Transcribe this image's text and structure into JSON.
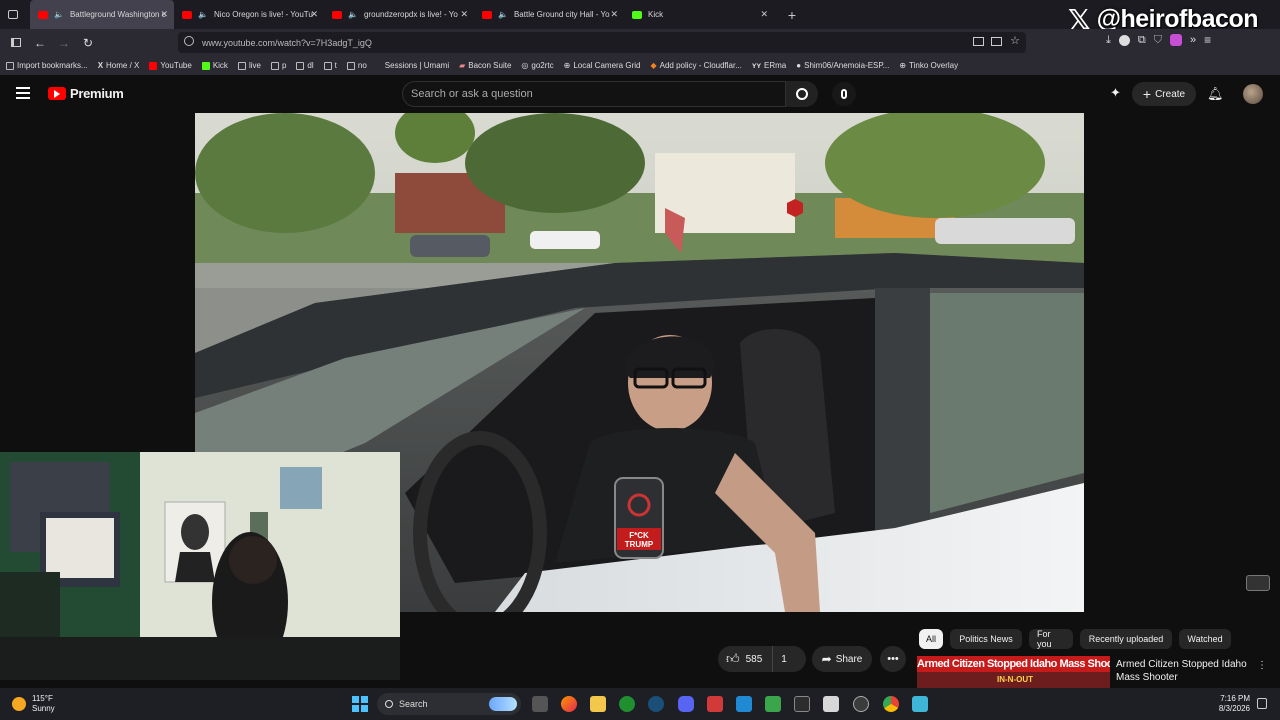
{
  "tabs": [
    {
      "title": "Battleground Washington c",
      "active": true,
      "audio": true
    },
    {
      "title": "Nico Oregon is live! - YouTu",
      "active": false,
      "audio": true
    },
    {
      "title": "groundzeropdx is live! - Yo",
      "active": false,
      "audio": true
    },
    {
      "title": "Battle Ground city Hall - Yo",
      "active": false,
      "audio": true
    },
    {
      "title": "Kick",
      "active": false,
      "audio": false
    }
  ],
  "overlay_handle": "@heirofbacon",
  "url": "www.youtube.com/watch?v=7H3adgT_igQ",
  "bookmarks": [
    "Import bookmarks...",
    "Home / X",
    "YouTube",
    "Kick",
    "live",
    "p",
    "dl",
    "t",
    "no",
    "Sessions | Umami",
    "Bacon Suite",
    "go2rtc",
    "Local Camera Grid",
    "Add policy - Cloudflar...",
    "ERma",
    "Shim06/Anemoia-ESP...",
    "Tinko Overlay"
  ],
  "youtube": {
    "logo_label": "Premium",
    "search_placeholder": "Search or ask a question",
    "create_label": "Create"
  },
  "actions": {
    "likes": "585",
    "dislikes": "1",
    "share_label": "Share"
  },
  "chips": [
    "All",
    "Politics News",
    "For you",
    "Recently uploaded",
    "Watched"
  ],
  "recommendation": {
    "thumb_text": "Armed Citizen Stopped Idaho Mass Shooter",
    "title": "Armed Citizen Stopped Idaho Mass Shooter",
    "thumb_sub": "IN-N-OUT"
  },
  "phone_case_text": "F*CK\nTRUMP",
  "weather": {
    "temp": "115°F",
    "cond": "Sunny"
  },
  "taskbar": {
    "search_label": "Search"
  },
  "clock": {
    "time": "7:16 PM",
    "date": "8/3/2026"
  }
}
